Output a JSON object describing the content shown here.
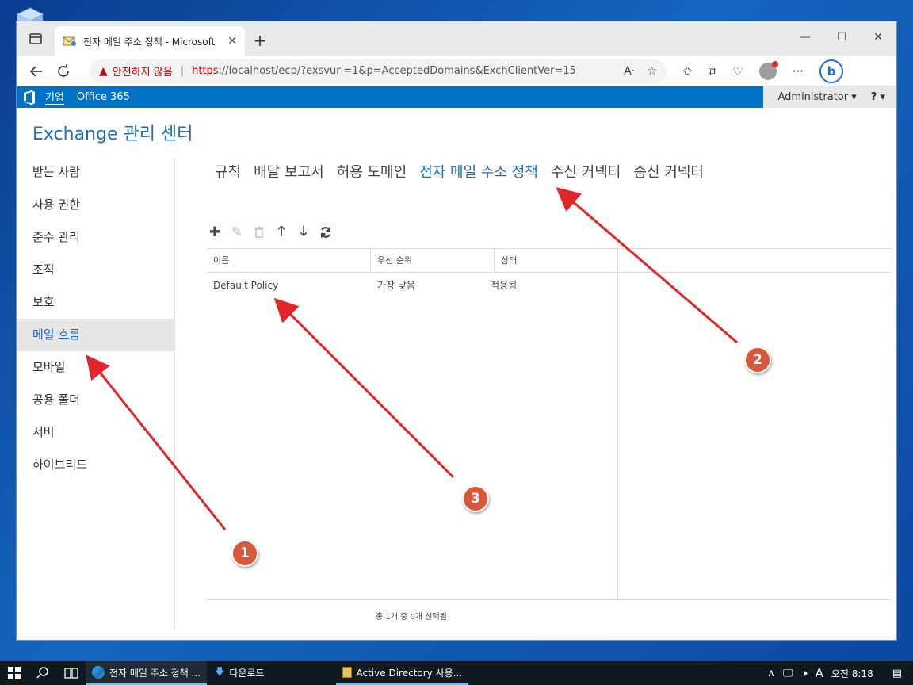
{
  "browser": {
    "tab_title": "전자 메일 주소 정책 - Microsoft",
    "tab_close": "✕",
    "new_tab": "+",
    "win_minimize": "—",
    "win_maximize": "☐",
    "win_close": "✕",
    "security_text": "안전하지 않음",
    "url_scheme": "https",
    "url_rest": "://localhost/ecp/?exsvurl=1&p=AcceptedDomains&ExchClientVer=15"
  },
  "o365": {
    "nav_enterprise": "기업",
    "nav_office365": "Office 365",
    "admin_name": "Administrator",
    "help": "?"
  },
  "page": {
    "title": "Exchange 관리 센터"
  },
  "left_nav": {
    "items": [
      {
        "label": "받는 사람"
      },
      {
        "label": "사용 권한"
      },
      {
        "label": "준수 관리"
      },
      {
        "label": "조직"
      },
      {
        "label": "보호"
      },
      {
        "label": "메일 흐름"
      },
      {
        "label": "모바일"
      },
      {
        "label": "공용 폴더"
      },
      {
        "label": "서버"
      },
      {
        "label": "하이브리드"
      }
    ],
    "active_index": 5
  },
  "top_tabs": {
    "items": [
      {
        "label": "규칙"
      },
      {
        "label": "배달 보고서"
      },
      {
        "label": "허용 도메인"
      },
      {
        "label": "전자 메일 주소 정책"
      },
      {
        "label": "수신 커넥터"
      },
      {
        "label": "송신 커넥터"
      }
    ],
    "active_index": 3
  },
  "grid": {
    "columns": [
      "이름",
      "우선 순위",
      "상태"
    ],
    "rows": [
      {
        "name": "Default Policy",
        "priority": "가장 낮음",
        "status": "적용됨"
      }
    ],
    "status_text": "총 1개 중 0개 선택됨"
  },
  "annotations": {
    "badge1": "1",
    "badge2": "2",
    "badge3": "3",
    "color": "#e0262a"
  },
  "taskbar": {
    "edge_task": "전자 메일 주소 정책 ...",
    "downloads_task": "다운로드",
    "ad_task": "Active Directory 사용...",
    "ime": "A",
    "ampm": "오전",
    "time": "8:18"
  },
  "colors": {
    "accent": "#1f6eb8",
    "o365_bar": "#0072c6",
    "badge": "#d9583b"
  }
}
